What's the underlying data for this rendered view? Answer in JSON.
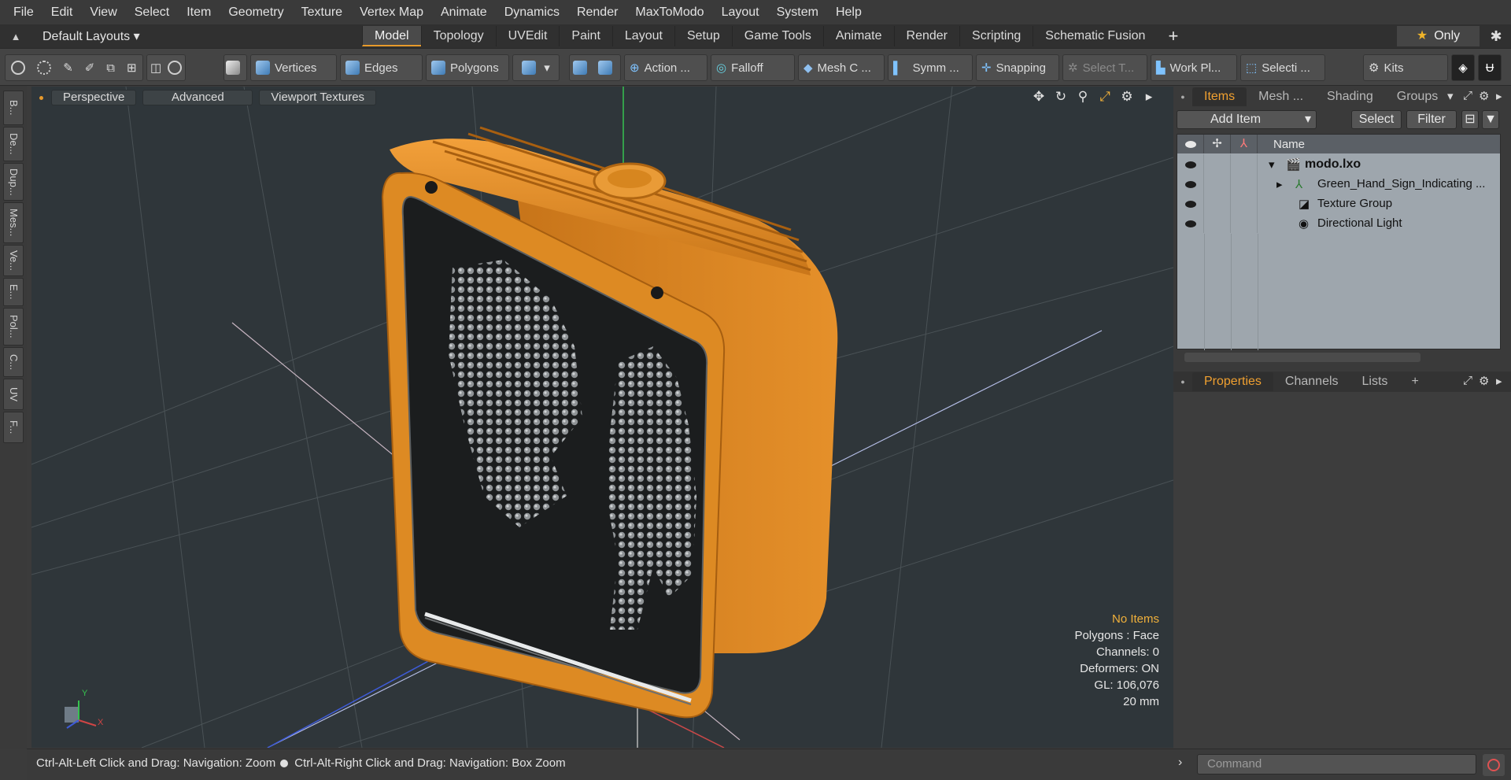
{
  "menu": [
    "File",
    "Edit",
    "View",
    "Select",
    "Item",
    "Geometry",
    "Texture",
    "Vertex Map",
    "Animate",
    "Dynamics",
    "Render",
    "MaxToModo",
    "Layout",
    "System",
    "Help"
  ],
  "layouts_label": "Default Layouts ▾",
  "layout_tabs": [
    "Model",
    "Topology",
    "UVEdit",
    "Paint",
    "Layout",
    "Setup",
    "Game Tools",
    "Animate",
    "Render",
    "Scripting",
    "Schematic Fusion"
  ],
  "active_layout_tab": "Model",
  "only_label": "Only",
  "toolbar": {
    "vertices": "Vertices",
    "edges": "Edges",
    "polygons": "Polygons",
    "action": "Action ...",
    "falloff": "Falloff",
    "mesh": "Mesh C ...",
    "symmetry": "Symm ...",
    "snapping": "Snapping",
    "select_t": "Select T...",
    "work_plane": "Work Pl...",
    "selection": "Selecti ...",
    "kits": "Kits"
  },
  "left_tabs": [
    "B...",
    "De...",
    "Dup...",
    "Mes...",
    "Ve...",
    "E...",
    "Pol...",
    "C...",
    "UV",
    "F..."
  ],
  "viewport": {
    "perspective": "Perspective",
    "advanced": "Advanced",
    "textures": "Viewport Textures",
    "info": {
      "no_items": "No Items",
      "polygons": "Polygons : Face",
      "channels": "Channels: 0",
      "deformers": "Deformers: ON",
      "gl": "GL: 106,076",
      "size": "20 mm"
    },
    "axis_y": "Y",
    "axis_x": "X"
  },
  "items_panel": {
    "tabs": [
      "Items",
      "Mesh ...",
      "Shading",
      "Groups"
    ],
    "add_item": "Add Item",
    "select": "Select",
    "filter": "Filter",
    "name_header": "Name",
    "rows": [
      {
        "label": "modo.lxo"
      },
      {
        "label": "Green_Hand_Sign_Indicating ..."
      },
      {
        "label": "Texture Group"
      },
      {
        "label": "Directional Light"
      }
    ]
  },
  "properties_panel": {
    "tabs": [
      "Properties",
      "Channels",
      "Lists"
    ]
  },
  "status": {
    "left": "Ctrl-Alt-Left Click and Drag: Navigation: Zoom",
    "right": "Ctrl-Alt-Right Click and Drag: Navigation: Box Zoom"
  },
  "command_placeholder": "Command",
  "colors": {
    "accent": "#e79a2b",
    "housing": "#d9841f",
    "viewport_bg": "#2f363a"
  }
}
